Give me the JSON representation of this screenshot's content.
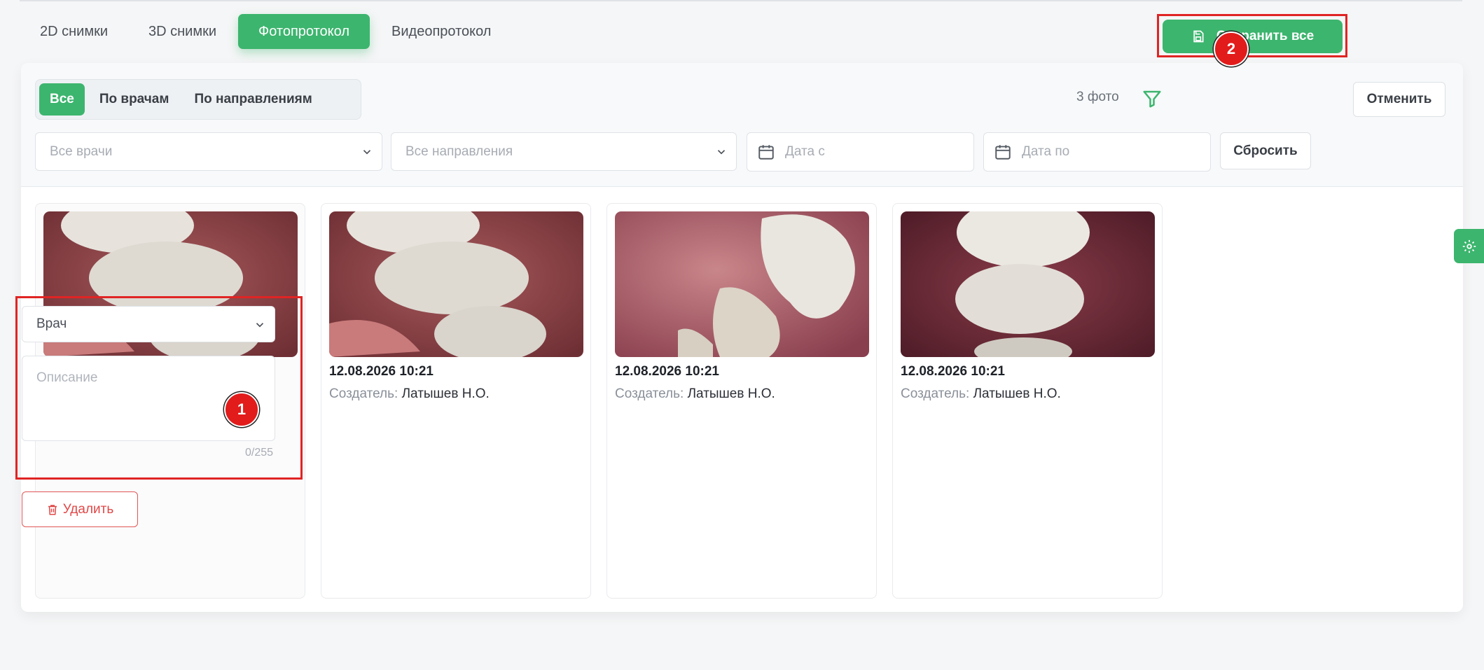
{
  "tabs": [
    {
      "label": "2D снимки",
      "active": false
    },
    {
      "label": "3D снимки",
      "active": false
    },
    {
      "label": "Фотопротокол",
      "active": true
    },
    {
      "label": "Видеопротокол",
      "active": false
    }
  ],
  "grouping": [
    {
      "label": "Все",
      "active": true
    },
    {
      "label": "По врачам",
      "active": false
    },
    {
      "label": "По направлениям",
      "active": false
    }
  ],
  "toolbar": {
    "count": "3 фото",
    "save_label": "Сохранить все",
    "cancel_label": "Отменить"
  },
  "filters": {
    "doctors_placeholder": "Все врачи",
    "directions_placeholder": "Все направления",
    "date_from_placeholder": "Дата с",
    "date_to_placeholder": "Дата по",
    "reset_label": "Сбросить"
  },
  "new_photo": {
    "doctor_placeholder": "Врач",
    "description_placeholder": "Описание",
    "description_counter": "0/255",
    "delete_label": "Удалить"
  },
  "photos": [
    {
      "date": "12.08.2026 10:21",
      "creator_label": "Создатель:",
      "creator": "Латышев Н.О."
    },
    {
      "date": "12.08.2026 10:21",
      "creator_label": "Создатель:",
      "creator": "Латышев Н.О."
    },
    {
      "date": "12.08.2026 10:21",
      "creator_label": "Создатель:",
      "creator": "Латышев Н.О."
    }
  ],
  "markers": {
    "one": "1",
    "two": "2"
  },
  "colors": {
    "accent": "#3cb56e",
    "annotation": "#e21b1b",
    "danger": "#e04848"
  }
}
